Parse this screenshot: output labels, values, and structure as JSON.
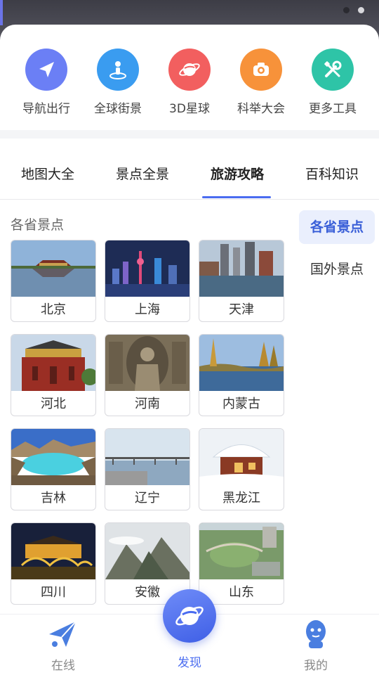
{
  "quick_actions": [
    {
      "label": "导航出行",
      "icon": "navigate-icon",
      "color": "#6b7ff5"
    },
    {
      "label": "全球街景",
      "icon": "street-view-icon",
      "color": "#3a9cf0"
    },
    {
      "label": "3D星球",
      "icon": "planet-icon",
      "color": "#f25f5f"
    },
    {
      "label": "科举大会",
      "icon": "quiz-icon",
      "color": "#f7923a"
    },
    {
      "label": "更多工具",
      "icon": "tools-icon",
      "color": "#2ec4a7"
    }
  ],
  "tabs": [
    "地图大全",
    "景点全景",
    "旅游攻略",
    "百科知识"
  ],
  "active_tab": "旅游攻略",
  "section_title": "各省景点",
  "side_nav": [
    "各省景点",
    "国外景点"
  ],
  "active_side": "各省景点",
  "provinces": [
    "北京",
    "上海",
    "天津",
    "河北",
    "河南",
    "内蒙古",
    "吉林",
    "辽宁",
    "黑龙江",
    "四川",
    "安徽",
    "山东"
  ],
  "bottom_nav": {
    "left_label": "在线",
    "center_label": "发现",
    "right_label": "我的"
  },
  "accent_color": "#4a6cf0"
}
